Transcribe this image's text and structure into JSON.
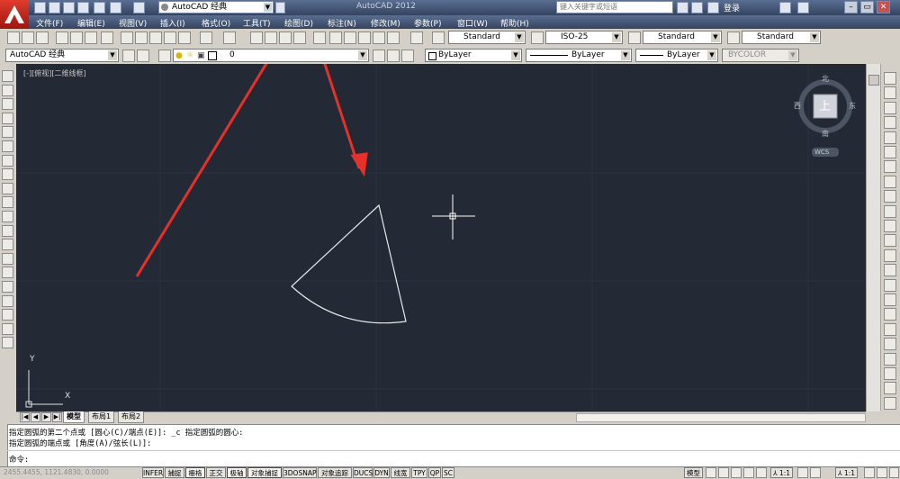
{
  "title_bar": {
    "workspace": "AutoCAD 经典",
    "app_title": "AutoCAD 2012",
    "search_placeholder": "键入关键字或短语",
    "login": "登录"
  },
  "menu": [
    "文件(F)",
    "编辑(E)",
    "视图(V)",
    "插入(I)",
    "格式(O)",
    "工具(T)",
    "绘图(D)",
    "标注(N)",
    "修改(M)",
    "参数(P)",
    "窗口(W)",
    "帮助(H)"
  ],
  "styles_toolbar": {
    "text_style": "Standard",
    "dim_style": "ISO-25",
    "table_style": "Standard",
    "multileader_style": "Standard"
  },
  "layers_toolbar": {
    "workspace": "AutoCAD 经典",
    "layer": "0",
    "color": "ByLayer",
    "linetype": "ByLayer",
    "lineweight": "ByLayer",
    "plotstyle": "BYCOLOR"
  },
  "viewport": {
    "label": "[-][俯视][二维线框]",
    "compass": {
      "north": "北",
      "south": "南",
      "east": "东",
      "west": "西",
      "top": "上",
      "wcs": "WCS"
    },
    "ucs_x": "X",
    "ucs_y": "Y"
  },
  "tabs": [
    "模型",
    "布局1",
    "布局2"
  ],
  "command": {
    "line1": "指定圆弧的第二个点或 [圆心(C)/端点(E)]: _c 指定圆弧的圆心:",
    "line2": "指定圆弧的端点或 [角度(A)/弦长(L)]:",
    "prompt": "命令:"
  },
  "status_bar": {
    "coords": "2455.4455, 1121.4830, 0.0000",
    "toggles": [
      "INFER",
      "捕捉",
      "栅格",
      "正交",
      "极轴",
      "对象捕捉",
      "3DOSNAP",
      "对象追踪",
      "DUCS",
      "DYN",
      "线宽",
      "TPY",
      "QP",
      "SC"
    ],
    "model": "模型",
    "scale1": "1:1",
    "scale2": "1:1"
  },
  "colors": {
    "canvas": "#242a35",
    "arrow": "#e8302a",
    "chrome": "#34435f"
  }
}
